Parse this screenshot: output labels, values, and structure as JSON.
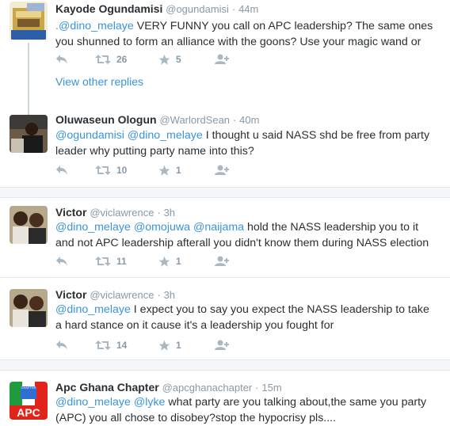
{
  "tweets": [
    {
      "name": "Kayode Ogundamisi",
      "handle": "@ogundamisi",
      "time": "44m",
      "text": [
        {
          "m": ".@dino_melaye"
        },
        {
          "t": " VERY FUNNY you call on APC leadership? The same ones you shunned to form an alliance with the goons? Use your magic wand or"
        }
      ],
      "retweets": "26",
      "favorites": "5"
    },
    {
      "name": "Oluwaseun Ologun",
      "handle": "@WarlordSean",
      "time": "40m",
      "text": [
        {
          "m": "@ogundamisi"
        },
        {
          "t": " "
        },
        {
          "m": "@dino_melaye"
        },
        {
          "t": "  I thought u said NASS shd be free from party leader why putting party name into this?"
        }
      ],
      "retweets": "10",
      "favorites": "1"
    },
    {
      "name": "Victor",
      "handle": "@viclawrence",
      "time": "3h",
      "text": [
        {
          "m": "@dino_melaye"
        },
        {
          "t": " "
        },
        {
          "m": "@omojuwa"
        },
        {
          "t": " "
        },
        {
          "m": "@naijama"
        },
        {
          "t": " hold the NASS leadership you to it and not APC leadership afterall you didn't know them during NASS election"
        }
      ],
      "retweets": "11",
      "favorites": "1"
    },
    {
      "name": "Victor",
      "handle": "@viclawrence",
      "time": "3h",
      "text": [
        {
          "m": "@dino_melaye"
        },
        {
          "t": " I expect you to say you expect the NASS leadership to take a hard stance on it cause it's a leadership you fought for"
        }
      ],
      "retweets": "14",
      "favorites": "1"
    },
    {
      "name": "Apc Ghana Chapter",
      "handle": "@apcghanachapter",
      "time": "15m",
      "text": [
        {
          "m": "@dino_melaye"
        },
        {
          "t": " "
        },
        {
          "m": "@lyke"
        },
        {
          "t": " what party are you talking about,the same you party (APC) you all chose to disobey?stop the hypocrisy pls...."
        }
      ]
    }
  ],
  "view_other_replies": "View other replies",
  "time_separator": "·",
  "avatar5_text": "APC",
  "avatar5_top_text": "CHAPTER",
  "icons": [
    "reply-icon",
    "retweet-icon",
    "favorite-icon",
    "follow-icon"
  ],
  "colors": {
    "mention": "#3b94d9",
    "muted": "#8899a6",
    "icon": "#aab8c2",
    "separator": "#e1e8ed"
  }
}
